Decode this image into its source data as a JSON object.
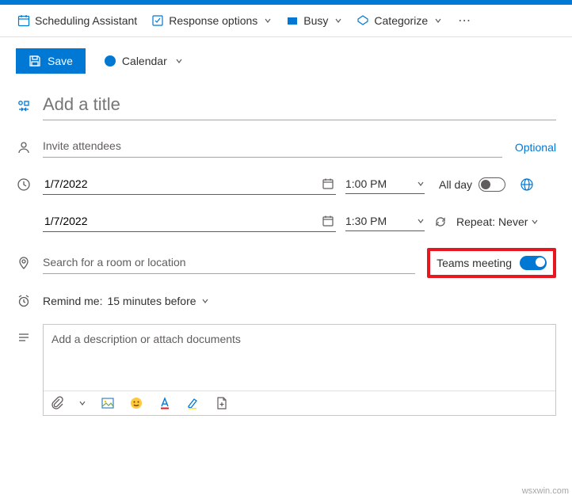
{
  "toolbar": {
    "scheduling": "Scheduling Assistant",
    "response": "Response options",
    "busy": "Busy",
    "categorize": "Categorize"
  },
  "save": {
    "label": "Save"
  },
  "calendar": {
    "label": "Calendar"
  },
  "title": {
    "placeholder": "Add a title"
  },
  "attendees": {
    "placeholder": "Invite attendees",
    "optional": "Optional"
  },
  "date": {
    "start_date": "1/7/2022",
    "start_time": "1:00 PM",
    "end_date": "1/7/2022",
    "end_time": "1:30 PM",
    "all_day": "All day",
    "repeat_label": "Repeat:",
    "repeat_value": "Never"
  },
  "location": {
    "placeholder": "Search for a room or location",
    "teams_label": "Teams meeting"
  },
  "reminder": {
    "prefix": "Remind me:",
    "value": "15 minutes before"
  },
  "description": {
    "placeholder": "Add a description or attach documents"
  },
  "watermark": "wsxwin.com"
}
